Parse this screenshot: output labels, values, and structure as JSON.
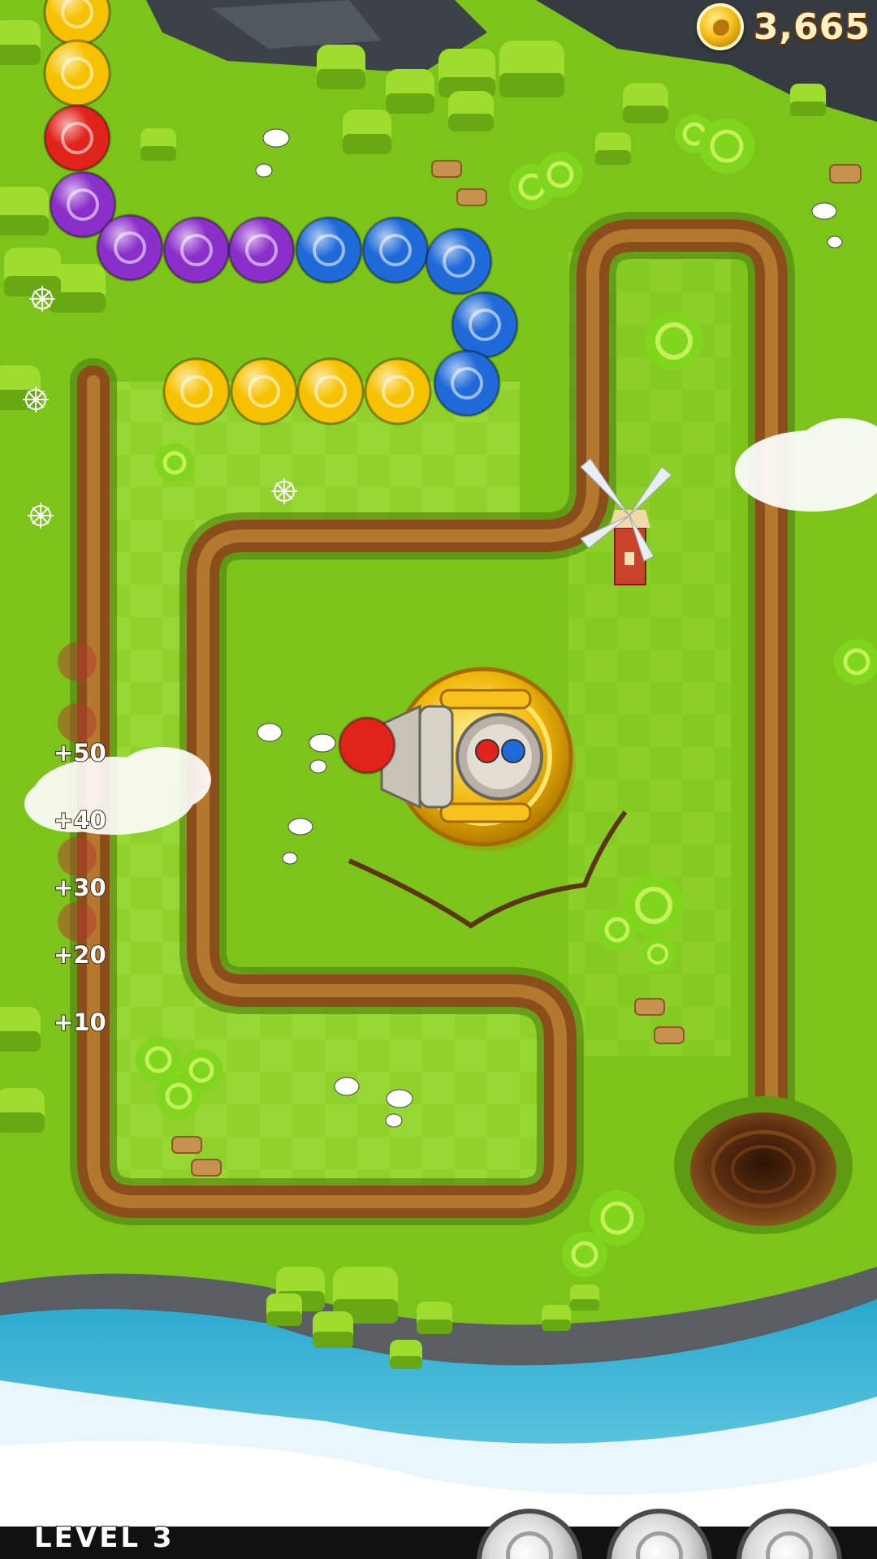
{
  "hud": {
    "coins": "3,665",
    "level_label": "LEVEL 3"
  },
  "score_markers": [
    "+50",
    "+40",
    "+30",
    "+20",
    "+10"
  ],
  "powerups": [
    {
      "name": "powerup-1-icon"
    },
    {
      "name": "powerup-2-icon"
    },
    {
      "name": "powerup-3-icon"
    }
  ],
  "colors": {
    "grass": "#7cc31a",
    "track": "#8a4e1b",
    "water": "#3cb6d6",
    "ball_yellow": "#f6c200",
    "ball_red": "#e0231b",
    "ball_purple": "#8a2fc9",
    "ball_blue": "#1f6ad8",
    "coin_text": "#fff2c2"
  },
  "ball_chain": [
    "yellow",
    "yellow",
    "red",
    "purple",
    "purple",
    "purple",
    "purple",
    "blue",
    "blue",
    "blue",
    "blue",
    "blue",
    "yellow",
    "yellow",
    "yellow",
    "yellow"
  ],
  "shooter": {
    "loaded_ball": "red",
    "next_balls": [
      "red",
      "blue"
    ]
  }
}
